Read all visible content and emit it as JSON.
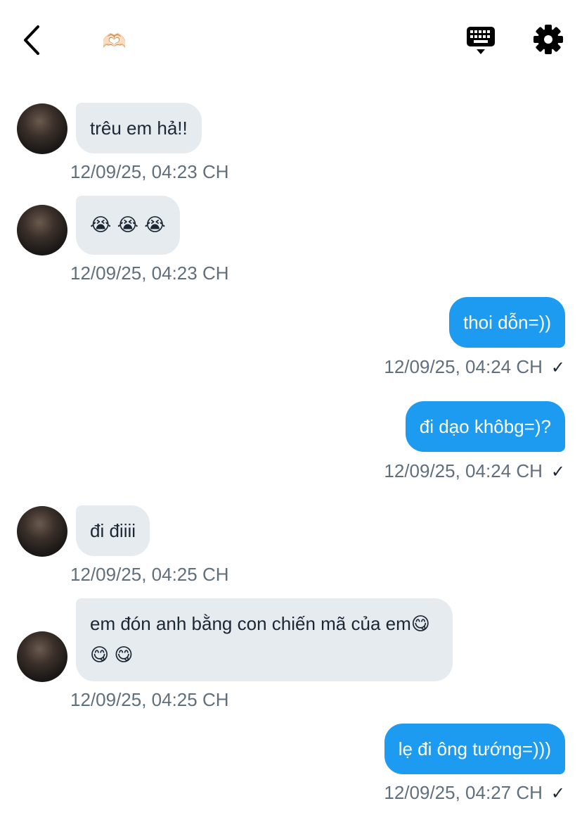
{
  "header": {
    "title_emoji": "🫶🏻",
    "back_icon": "chevron-left-icon",
    "keyboard_icon": "keyboard-icon",
    "settings_icon": "gear-icon"
  },
  "messages": [
    {
      "direction": "in",
      "text": "trêu em hả!!",
      "time": "12/09/25, 04:23 CH"
    },
    {
      "direction": "in",
      "text": "😭 😭 😭",
      "time": "12/09/25, 04:23 CH"
    },
    {
      "direction": "out",
      "text": "thoi dỗn=))",
      "time": "12/09/25, 04:24 CH",
      "status": "✓"
    },
    {
      "direction": "out",
      "text": "đi dạo khôbg=)?",
      "time": "12/09/25, 04:24 CH",
      "status": "✓"
    },
    {
      "direction": "in",
      "text": "đi điiii",
      "time": "12/09/25, 04:25 CH"
    },
    {
      "direction": "in",
      "text": "em đón anh bằng con chiến mã của em😋 😋 😋",
      "time": "12/09/25, 04:25 CH"
    },
    {
      "direction": "out",
      "text": "lẹ đi ông tướng=)))",
      "time": "12/09/25, 04:27 CH",
      "status": "✓"
    }
  ],
  "colors": {
    "outgoing_bubble": "#1d9bf0",
    "incoming_bubble": "#e6ebf0",
    "timestamp": "#5f6f7e"
  }
}
